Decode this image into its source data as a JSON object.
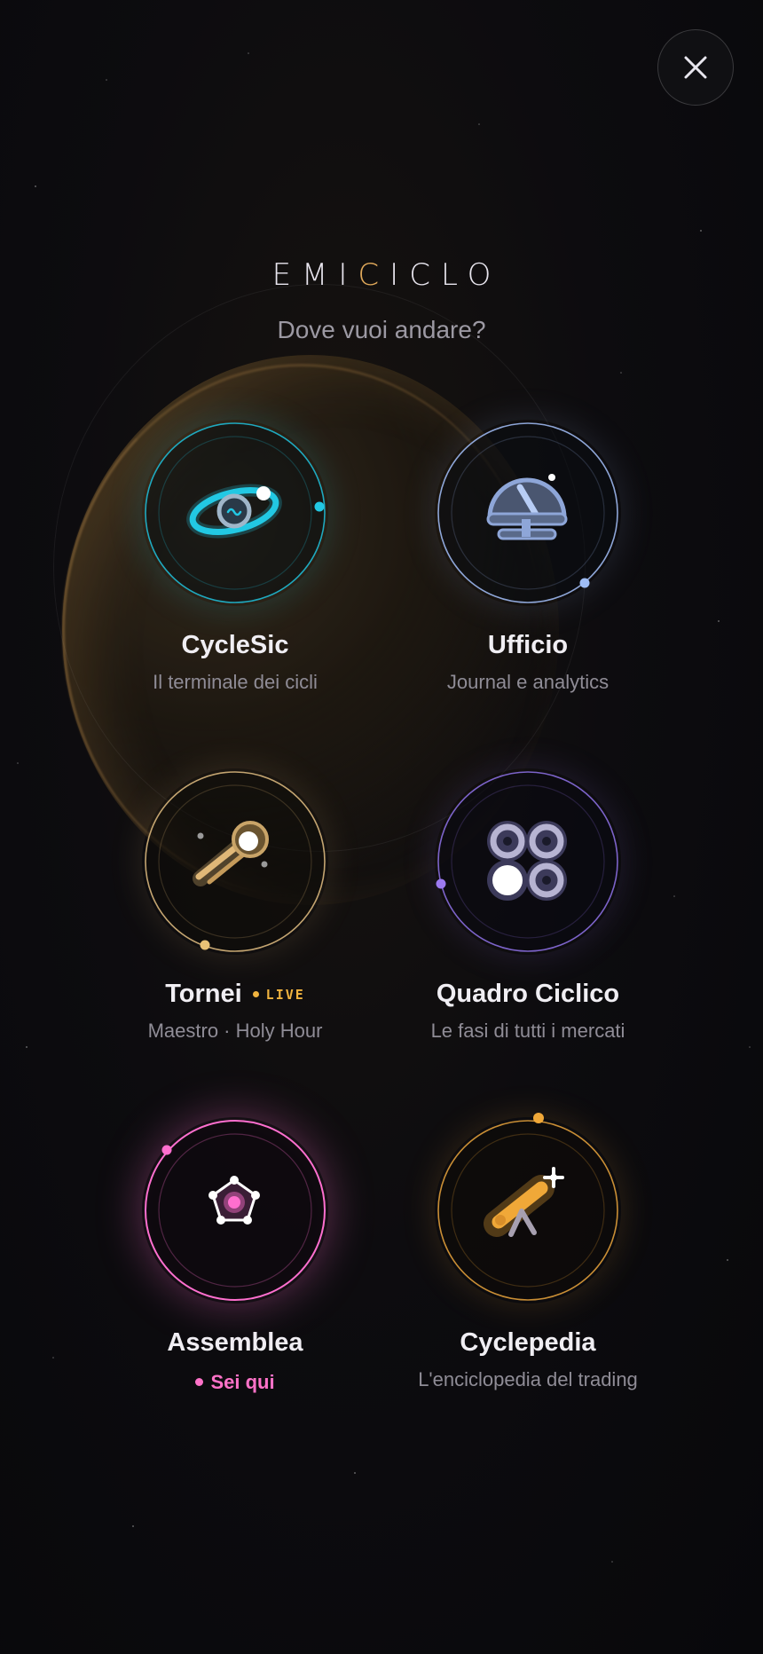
{
  "brand": {
    "pre": "EMI",
    "accent": "C",
    "post": "ICLO"
  },
  "subtitle": "Dove vuoi andare?",
  "close_icon": "close-icon",
  "colors": {
    "cyan": "#22c8e3",
    "slate": "#8ea6d8",
    "gold": "#e0b878",
    "violet": "#8f6de0",
    "pink": "#ff6fcf",
    "amber": "#f0a838",
    "live": "#f0b33f"
  },
  "items": [
    {
      "title": "CycleSic",
      "subtitle": "Il terminale dei cicli",
      "icon": "galaxy-icon"
    },
    {
      "title": "Ufficio",
      "subtitle": "Journal e analytics",
      "icon": "observatory-icon"
    },
    {
      "title": "Tornei",
      "badge": "LIVE",
      "subtitle": "Maestro · Holy Hour",
      "icon": "comet-icon"
    },
    {
      "title": "Quadro Ciclico",
      "subtitle": "Le fasi di tutti i mercati",
      "icon": "grid-cycles-icon"
    },
    {
      "title": "Assemblea",
      "subtitle": "Sei qui",
      "icon": "pentagon-network-icon"
    },
    {
      "title": "Cyclepedia",
      "subtitle": "L'enciclopedia del trading",
      "icon": "telescope-icon"
    }
  ]
}
